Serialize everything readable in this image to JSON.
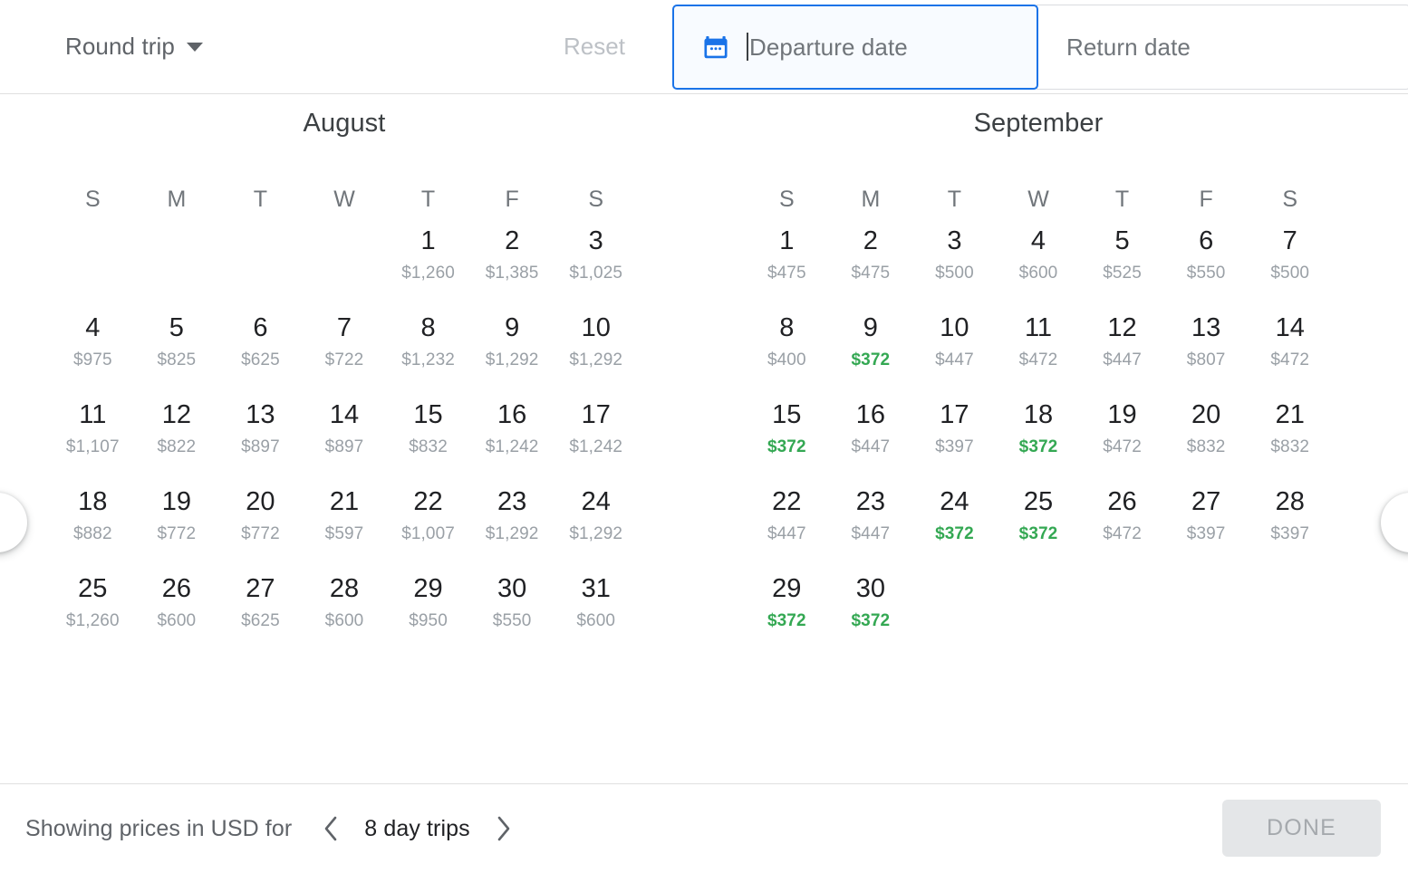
{
  "header": {
    "trip_type": "Round trip",
    "trip_type_icon": "chevron-down-icon",
    "reset_label": "Reset",
    "departure_placeholder": "Departure date",
    "departure_value": "",
    "return_placeholder": "Return date",
    "return_value": "",
    "calendar_icon": "calendar-icon",
    "focused_field": "departure"
  },
  "months": [
    {
      "name": "August",
      "weekdays": [
        "S",
        "M",
        "T",
        "W",
        "T",
        "F",
        "S"
      ],
      "lead_blanks": 4,
      "days": [
        {
          "day": "1",
          "price": "$1,260",
          "cheap": false
        },
        {
          "day": "2",
          "price": "$1,385",
          "cheap": false
        },
        {
          "day": "3",
          "price": "$1,025",
          "cheap": false
        },
        {
          "day": "4",
          "price": "$975",
          "cheap": false
        },
        {
          "day": "5",
          "price": "$825",
          "cheap": false
        },
        {
          "day": "6",
          "price": "$625",
          "cheap": false
        },
        {
          "day": "7",
          "price": "$722",
          "cheap": false
        },
        {
          "day": "8",
          "price": "$1,232",
          "cheap": false
        },
        {
          "day": "9",
          "price": "$1,292",
          "cheap": false
        },
        {
          "day": "10",
          "price": "$1,292",
          "cheap": false
        },
        {
          "day": "11",
          "price": "$1,107",
          "cheap": false
        },
        {
          "day": "12",
          "price": "$822",
          "cheap": false
        },
        {
          "day": "13",
          "price": "$897",
          "cheap": false
        },
        {
          "day": "14",
          "price": "$897",
          "cheap": false
        },
        {
          "day": "15",
          "price": "$832",
          "cheap": false
        },
        {
          "day": "16",
          "price": "$1,242",
          "cheap": false
        },
        {
          "day": "17",
          "price": "$1,242",
          "cheap": false
        },
        {
          "day": "18",
          "price": "$882",
          "cheap": false
        },
        {
          "day": "19",
          "price": "$772",
          "cheap": false
        },
        {
          "day": "20",
          "price": "$772",
          "cheap": false
        },
        {
          "day": "21",
          "price": "$597",
          "cheap": false
        },
        {
          "day": "22",
          "price": "$1,007",
          "cheap": false
        },
        {
          "day": "23",
          "price": "$1,292",
          "cheap": false
        },
        {
          "day": "24",
          "price": "$1,292",
          "cheap": false
        },
        {
          "day": "25",
          "price": "$1,260",
          "cheap": false
        },
        {
          "day": "26",
          "price": "$600",
          "cheap": false
        },
        {
          "day": "27",
          "price": "$625",
          "cheap": false
        },
        {
          "day": "28",
          "price": "$600",
          "cheap": false
        },
        {
          "day": "29",
          "price": "$950",
          "cheap": false
        },
        {
          "day": "30",
          "price": "$550",
          "cheap": false
        },
        {
          "day": "31",
          "price": "$600",
          "cheap": false
        }
      ]
    },
    {
      "name": "September",
      "weekdays": [
        "S",
        "M",
        "T",
        "W",
        "T",
        "F",
        "S"
      ],
      "lead_blanks": 0,
      "days": [
        {
          "day": "1",
          "price": "$475",
          "cheap": false
        },
        {
          "day": "2",
          "price": "$475",
          "cheap": false
        },
        {
          "day": "3",
          "price": "$500",
          "cheap": false
        },
        {
          "day": "4",
          "price": "$600",
          "cheap": false
        },
        {
          "day": "5",
          "price": "$525",
          "cheap": false
        },
        {
          "day": "6",
          "price": "$550",
          "cheap": false
        },
        {
          "day": "7",
          "price": "$500",
          "cheap": false
        },
        {
          "day": "8",
          "price": "$400",
          "cheap": false
        },
        {
          "day": "9",
          "price": "$372",
          "cheap": true
        },
        {
          "day": "10",
          "price": "$447",
          "cheap": false
        },
        {
          "day": "11",
          "price": "$472",
          "cheap": false
        },
        {
          "day": "12",
          "price": "$447",
          "cheap": false
        },
        {
          "day": "13",
          "price": "$807",
          "cheap": false
        },
        {
          "day": "14",
          "price": "$472",
          "cheap": false
        },
        {
          "day": "15",
          "price": "$372",
          "cheap": true
        },
        {
          "day": "16",
          "price": "$447",
          "cheap": false
        },
        {
          "day": "17",
          "price": "$397",
          "cheap": false
        },
        {
          "day": "18",
          "price": "$372",
          "cheap": true
        },
        {
          "day": "19",
          "price": "$472",
          "cheap": false
        },
        {
          "day": "20",
          "price": "$832",
          "cheap": false
        },
        {
          "day": "21",
          "price": "$832",
          "cheap": false
        },
        {
          "day": "22",
          "price": "$447",
          "cheap": false
        },
        {
          "day": "23",
          "price": "$447",
          "cheap": false
        },
        {
          "day": "24",
          "price": "$372",
          "cheap": true
        },
        {
          "day": "25",
          "price": "$372",
          "cheap": true
        },
        {
          "day": "26",
          "price": "$472",
          "cheap": false
        },
        {
          "day": "27",
          "price": "$397",
          "cheap": false
        },
        {
          "day": "28",
          "price": "$397",
          "cheap": false
        },
        {
          "day": "29",
          "price": "$372",
          "cheap": true
        },
        {
          "day": "30",
          "price": "$372",
          "cheap": true
        }
      ]
    }
  ],
  "nav": {
    "prev_month_icon": "chevron-left-circle-icon",
    "next_month_icon": "chevron-right-circle-icon"
  },
  "footer": {
    "note": "Showing prices in USD for",
    "prev_icon": "chevron-left-icon",
    "trip_length": "8 day trips",
    "next_icon": "chevron-right-icon",
    "done_label": "DONE",
    "done_disabled": true
  },
  "colors": {
    "accent_blue": "#1a73e8",
    "cheap_green": "#34a853",
    "price_gray": "#9aa0a6",
    "text_dark": "#202124",
    "text_muted": "#5f6368",
    "reset_disabled": "#bdc1c6",
    "done_bg": "#e4e6e8"
  }
}
